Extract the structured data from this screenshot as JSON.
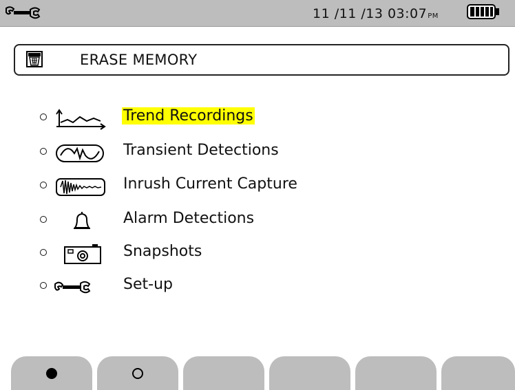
{
  "status_bar": {
    "date": "11 /11 /13",
    "time": "03:07",
    "ampm": "PM",
    "battery_level": 1.0
  },
  "title": {
    "icon": "trash-bin-icon",
    "text": "ERASE MEMORY"
  },
  "menu": {
    "items": [
      {
        "label": "Trend Recordings",
        "icon": "trend-icon",
        "selected": true
      },
      {
        "label": "Transient Detections",
        "icon": "transient-icon",
        "selected": false
      },
      {
        "label": "Inrush Current Capture",
        "icon": "inrush-icon",
        "selected": false
      },
      {
        "label": "Alarm Detections",
        "icon": "bell-icon",
        "selected": false
      },
      {
        "label": "Snapshots",
        "icon": "camera-icon",
        "selected": false
      },
      {
        "label": "Set-up",
        "icon": "wrench-icon",
        "selected": false
      }
    ]
  },
  "function_keys": [
    {
      "icon": "filled-dot-icon"
    },
    {
      "icon": "empty-dot-icon"
    },
    {
      "icon": ""
    },
    {
      "icon": ""
    },
    {
      "icon": ""
    },
    {
      "icon": ""
    }
  ],
  "colors": {
    "bar_gray": "#bdbdbd",
    "highlight": "#ffff00"
  }
}
